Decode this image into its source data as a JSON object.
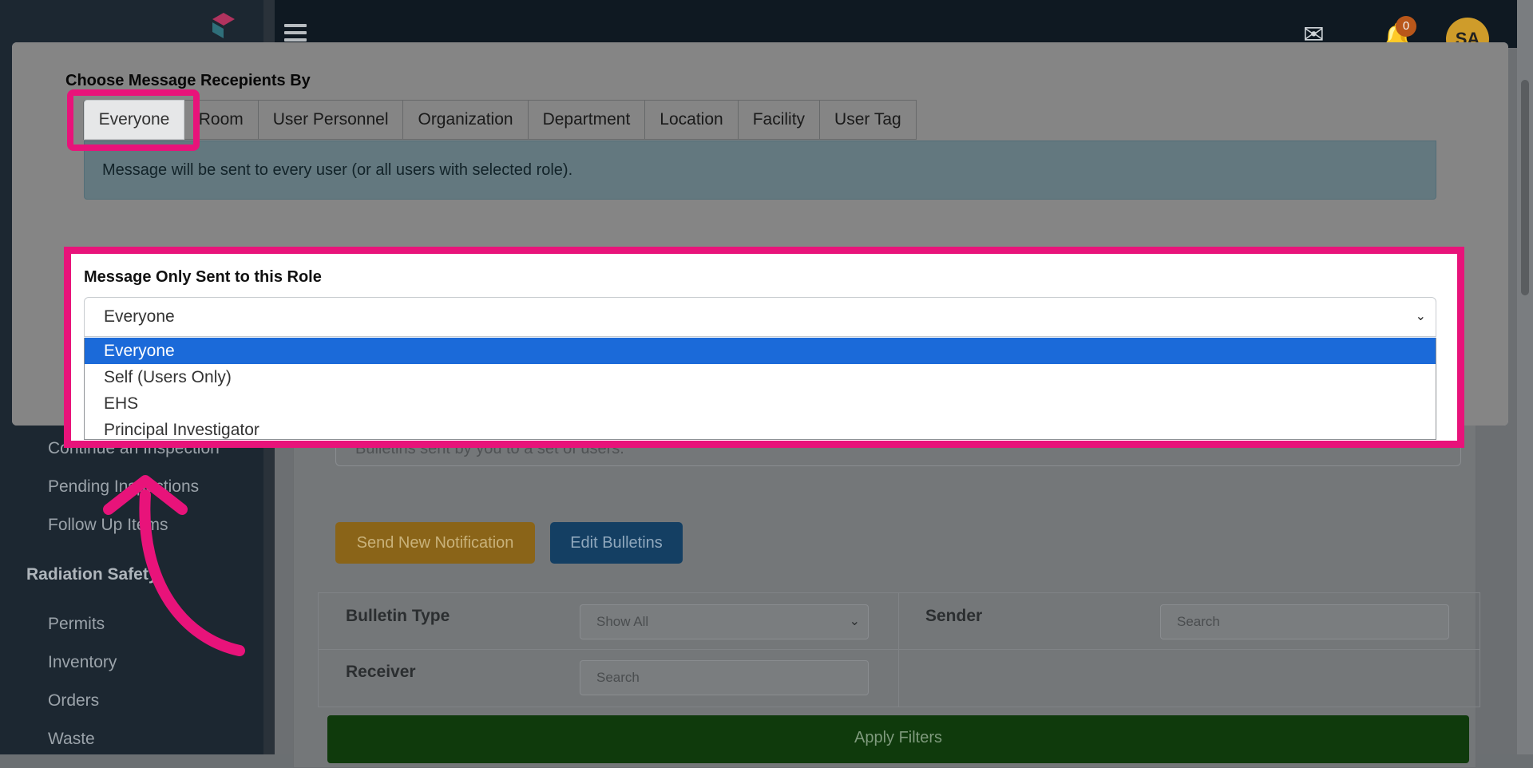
{
  "header": {
    "notification_count": "0",
    "avatar_initials": "SA"
  },
  "sidebar": {
    "items": [
      {
        "label": "Continue an Inspection"
      },
      {
        "label": "Pending Inspections"
      },
      {
        "label": "Follow Up Items"
      }
    ],
    "section_title": "Radiation Safety",
    "rad_items": [
      {
        "label": "Permits"
      },
      {
        "label": "Inventory"
      },
      {
        "label": "Orders"
      },
      {
        "label": "Waste"
      }
    ]
  },
  "main": {
    "note_text": "Bulletins sent by you to a set of users.",
    "send_button": "Send New Notification",
    "edit_button": "Edit Bulletins",
    "filters": {
      "bulletin_type_label": "Bulletin Type",
      "bulletin_type_value": "Show All",
      "sender_label": "Sender",
      "sender_placeholder": "Search",
      "receiver_label": "Receiver",
      "receiver_placeholder": "Search"
    },
    "apply_button": "Apply Filters"
  },
  "modal": {
    "title": "Choose Message Recepients By",
    "tabs": [
      {
        "label": "Everyone",
        "active": true
      },
      {
        "label": "Room"
      },
      {
        "label": "User Personnel"
      },
      {
        "label": "Organization"
      },
      {
        "label": "Department"
      },
      {
        "label": "Location"
      },
      {
        "label": "Facility"
      },
      {
        "label": "User Tag"
      }
    ],
    "info_text": "Message will be sent to every user (or all users with selected role).",
    "role_label": "Message Only Sent to this Role",
    "role_selected": "Everyone",
    "role_options": [
      {
        "label": "Everyone",
        "selected": true
      },
      {
        "label": "Self (Users Only)"
      },
      {
        "label": "EHS"
      },
      {
        "label": "Principal Investigator"
      }
    ]
  },
  "colors": {
    "highlight": "#e8137a",
    "option_selected": "#1b6ad9",
    "info_bg": "#bfe6f3"
  }
}
